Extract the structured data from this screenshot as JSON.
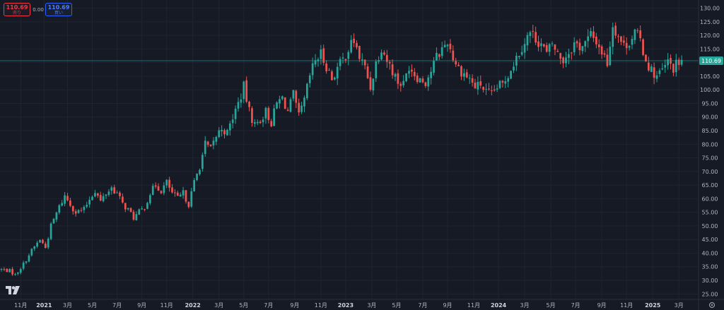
{
  "trade_panel": {
    "sell_price": "110.69",
    "sell_label": "売り",
    "spread": "0.00",
    "buy_price": "110.69",
    "buy_label": "買い"
  },
  "colors": {
    "background": "#161a25",
    "grid": "#1f2431",
    "up": "#26a69a",
    "down": "#ef5350",
    "last_price_bg": "#26a69a",
    "text": "#b2b5be"
  },
  "logo_icon": "tradingview-logo-icon",
  "settings_icon": "gear-icon",
  "chart_data": {
    "type": "candlestick",
    "title": "",
    "xlabel": "",
    "ylabel": "",
    "ylim": [
      23,
      133
    ],
    "grid": true,
    "last_price": 110.69,
    "last_price_label": "110.69",
    "y_ticks": [
      "130.00",
      "125.00",
      "120.00",
      "115.00",
      "110.00",
      "105.00",
      "100.00",
      "95.00",
      "90.00",
      "85.00",
      "80.00",
      "75.00",
      "70.00",
      "65.00",
      "60.00",
      "55.00",
      "50.00",
      "45.00",
      "40.00",
      "35.00",
      "30.00",
      "25.00"
    ],
    "x_ticks": [
      {
        "label": "11月",
        "t": 7,
        "bold": false
      },
      {
        "label": "2021",
        "t": 15.5,
        "bold": true
      },
      {
        "label": "3月",
        "t": 24,
        "bold": false
      },
      {
        "label": "5月",
        "t": 33,
        "bold": false
      },
      {
        "label": "7月",
        "t": 42,
        "bold": false
      },
      {
        "label": "9月",
        "t": 51,
        "bold": false
      },
      {
        "label": "11月",
        "t": 60,
        "bold": false
      },
      {
        "label": "2022",
        "t": 69.5,
        "bold": true
      },
      {
        "label": "3月",
        "t": 79,
        "bold": false
      },
      {
        "label": "5月",
        "t": 88,
        "bold": false
      },
      {
        "label": "7月",
        "t": 97,
        "bold": false
      },
      {
        "label": "9月",
        "t": 106.5,
        "bold": false
      },
      {
        "label": "11月",
        "t": 116,
        "bold": false
      },
      {
        "label": "2023",
        "t": 125,
        "bold": true
      },
      {
        "label": "3月",
        "t": 134.5,
        "bold": false
      },
      {
        "label": "5月",
        "t": 143.5,
        "bold": false
      },
      {
        "label": "7月",
        "t": 153,
        "bold": false
      },
      {
        "label": "9月",
        "t": 162,
        "bold": false
      },
      {
        "label": "11月",
        "t": 171.5,
        "bold": false
      },
      {
        "label": "2024",
        "t": 180.5,
        "bold": true
      },
      {
        "label": "3月",
        "t": 190,
        "bold": false
      },
      {
        "label": "5月",
        "t": 199.5,
        "bold": false
      },
      {
        "label": "7月",
        "t": 208.5,
        "bold": false
      },
      {
        "label": "9月",
        "t": 218,
        "bold": false
      },
      {
        "label": "11月",
        "t": 227,
        "bold": false
      },
      {
        "label": "2025",
        "t": 236.5,
        "bold": true
      },
      {
        "label": "3月",
        "t": 246,
        "bold": false
      }
    ],
    "path_points": [
      [
        0,
        34
      ],
      [
        3,
        33.5
      ],
      [
        5,
        32
      ],
      [
        8,
        36
      ],
      [
        11,
        41
      ],
      [
        14,
        45
      ],
      [
        16,
        42
      ],
      [
        18,
        50
      ],
      [
        21,
        57
      ],
      [
        23,
        61
      ],
      [
        25,
        58
      ],
      [
        27,
        55
      ],
      [
        30,
        56
      ],
      [
        32,
        60
      ],
      [
        34,
        63
      ],
      [
        36,
        59
      ],
      [
        38,
        62
      ],
      [
        40,
        64
      ],
      [
        42,
        62
      ],
      [
        44,
        58
      ],
      [
        46,
        56
      ],
      [
        48,
        53
      ],
      [
        50,
        55
      ],
      [
        52,
        57
      ],
      [
        54,
        62
      ],
      [
        56,
        65
      ],
      [
        58,
        63
      ],
      [
        60,
        66
      ],
      [
        62,
        62
      ],
      [
        64,
        60
      ],
      [
        66,
        62
      ],
      [
        68,
        58
      ],
      [
        70,
        66
      ],
      [
        72,
        72
      ],
      [
        74,
        80
      ],
      [
        76,
        78
      ],
      [
        78,
        83
      ],
      [
        80,
        86
      ],
      [
        82,
        84
      ],
      [
        84,
        90
      ],
      [
        86,
        95
      ],
      [
        88,
        101
      ],
      [
        90,
        92
      ],
      [
        92,
        87
      ],
      [
        94,
        89
      ],
      [
        96,
        92
      ],
      [
        98,
        88
      ],
      [
        100,
        95
      ],
      [
        102,
        97
      ],
      [
        104,
        92
      ],
      [
        106,
        98
      ],
      [
        108,
        90
      ],
      [
        110,
        96
      ],
      [
        112,
        105
      ],
      [
        114,
        111
      ],
      [
        116,
        113
      ],
      [
        118,
        109
      ],
      [
        120,
        104
      ],
      [
        122,
        108
      ],
      [
        124,
        111
      ],
      [
        126,
        115
      ],
      [
        128,
        118
      ],
      [
        130,
        112
      ],
      [
        132,
        108
      ],
      [
        134,
        101
      ],
      [
        136,
        110
      ],
      [
        138,
        116
      ],
      [
        140,
        111
      ],
      [
        142,
        107
      ],
      [
        144,
        103
      ],
      [
        146,
        102
      ],
      [
        148,
        109
      ],
      [
        150,
        106
      ],
      [
        152,
        104
      ],
      [
        154,
        103
      ],
      [
        156,
        107
      ],
      [
        158,
        112
      ],
      [
        160,
        115
      ],
      [
        162,
        118
      ],
      [
        164,
        112
      ],
      [
        166,
        108
      ],
      [
        168,
        106
      ],
      [
        170,
        104
      ],
      [
        172,
        101
      ],
      [
        174,
        102
      ],
      [
        176,
        99
      ],
      [
        178,
        98
      ],
      [
        180,
        101
      ],
      [
        182,
        102
      ],
      [
        184,
        106
      ],
      [
        186,
        110
      ],
      [
        188,
        114
      ],
      [
        190,
        118
      ],
      [
        192,
        121
      ],
      [
        194,
        119
      ],
      [
        196,
        117
      ],
      [
        198,
        113
      ],
      [
        200,
        117
      ],
      [
        202,
        113
      ],
      [
        204,
        111
      ],
      [
        206,
        114
      ],
      [
        208,
        117
      ],
      [
        210,
        116
      ],
      [
        212,
        117
      ],
      [
        214,
        120
      ],
      [
        216,
        118
      ],
      [
        218,
        114
      ],
      [
        220,
        110
      ],
      [
        222,
        124
      ],
      [
        224,
        120
      ],
      [
        226,
        116
      ],
      [
        228,
        118
      ],
      [
        230,
        121
      ],
      [
        232,
        118
      ],
      [
        234,
        111
      ],
      [
        236,
        107
      ],
      [
        238,
        105
      ],
      [
        240,
        107
      ],
      [
        242,
        110
      ],
      [
        244,
        108
      ],
      [
        246,
        110
      ],
      [
        247,
        110.7
      ]
    ]
  }
}
